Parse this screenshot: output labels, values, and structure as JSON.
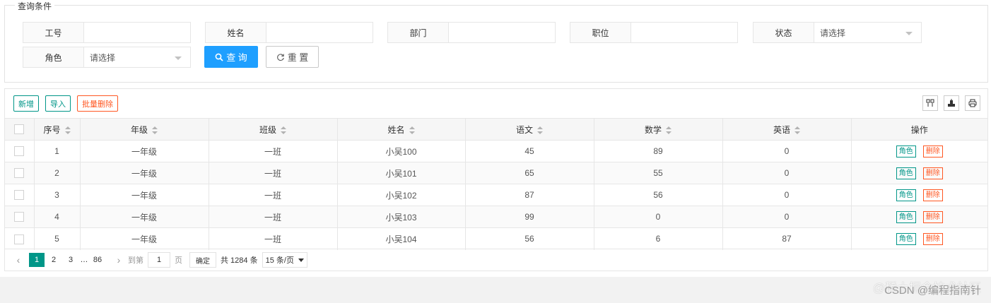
{
  "query": {
    "legend": "查询条件",
    "fields": [
      {
        "label": "工号",
        "value": ""
      },
      {
        "label": "姓名",
        "value": ""
      },
      {
        "label": "部门",
        "value": ""
      },
      {
        "label": "职位",
        "value": ""
      },
      {
        "label": "状态",
        "value": "请选择"
      },
      {
        "label": "角色",
        "value": "请选择"
      }
    ],
    "search_label": "查 询",
    "reset_label": "重 置"
  },
  "toolbar": {
    "add_label": "新增",
    "import_label": "导入",
    "batch_delete_label": "批量删除",
    "right_icons": [
      "columns-icon",
      "export-icon",
      "print-icon"
    ]
  },
  "table": {
    "headers": [
      "序号",
      "年级",
      "班级",
      "姓名",
      "语文",
      "数学",
      "英语",
      "操作"
    ],
    "rows": [
      {
        "no": "1",
        "grade": "一年级",
        "class": "一班",
        "name": "小吴100",
        "chinese": "45",
        "math": "89",
        "english": "0"
      },
      {
        "no": "2",
        "grade": "一年级",
        "class": "一班",
        "name": "小吴101",
        "chinese": "65",
        "math": "55",
        "english": "0"
      },
      {
        "no": "3",
        "grade": "一年级",
        "class": "一班",
        "name": "小吴102",
        "chinese": "87",
        "math": "56",
        "english": "0"
      },
      {
        "no": "4",
        "grade": "一年级",
        "class": "一班",
        "name": "小吴103",
        "chinese": "99",
        "math": "0",
        "english": "0"
      },
      {
        "no": "5",
        "grade": "一年级",
        "class": "一班",
        "name": "小吴104",
        "chinese": "56",
        "math": "6",
        "english": "87"
      }
    ],
    "role_label": "角色",
    "delete_label": "删除"
  },
  "pager": {
    "prev": "‹",
    "pages": [
      "1",
      "2",
      "3"
    ],
    "ellipsis": "…",
    "last": "86",
    "next": "›",
    "goto_label": "到第",
    "goto_value": "1",
    "page_unit": "页",
    "confirm_label": "确定",
    "total_label": "共 1284 条",
    "limit_label": "15 条/页"
  },
  "watermark": {
    "line1": "@稀土掘金技术社区",
    "line2": "CSDN @编程指南针"
  },
  "colors": {
    "primary": "#1e9fff",
    "teal": "#009688",
    "danger": "#ff5722"
  }
}
